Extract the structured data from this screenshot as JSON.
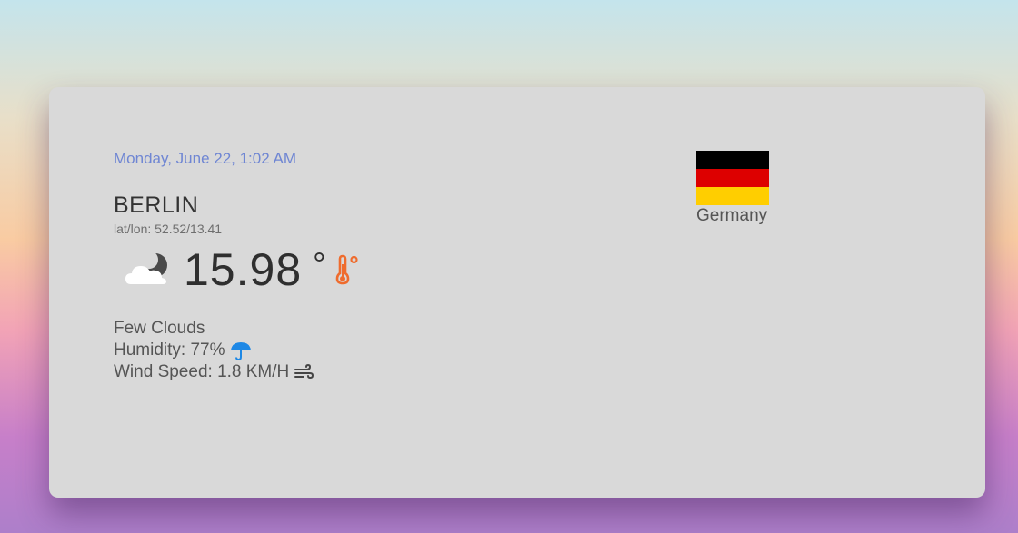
{
  "weather": {
    "date": "Monday, June 22, 1:02 AM",
    "city": "BERLIN",
    "coords": "lat/lon: 52.52/13.41",
    "temperature": "15.98",
    "temperature_unit": "°",
    "condition": "Few Clouds",
    "humidity": "Humidity: 77%",
    "wind": "Wind Speed: 1.8 KM/H",
    "condition_icon": "cloud-moon-icon",
    "temperature_icon": "thermometer-icon",
    "humidity_icon": "umbrella-icon",
    "wind_icon": "wind-icon"
  },
  "country": {
    "name": "Germany",
    "flag_colors": [
      "#000000",
      "#dd0000",
      "#ffce00"
    ]
  },
  "colors": {
    "card": "#d9d9d9",
    "date": "#6f86d3",
    "thermometer": "#ef6c2e",
    "umbrella": "#1e88e5"
  }
}
